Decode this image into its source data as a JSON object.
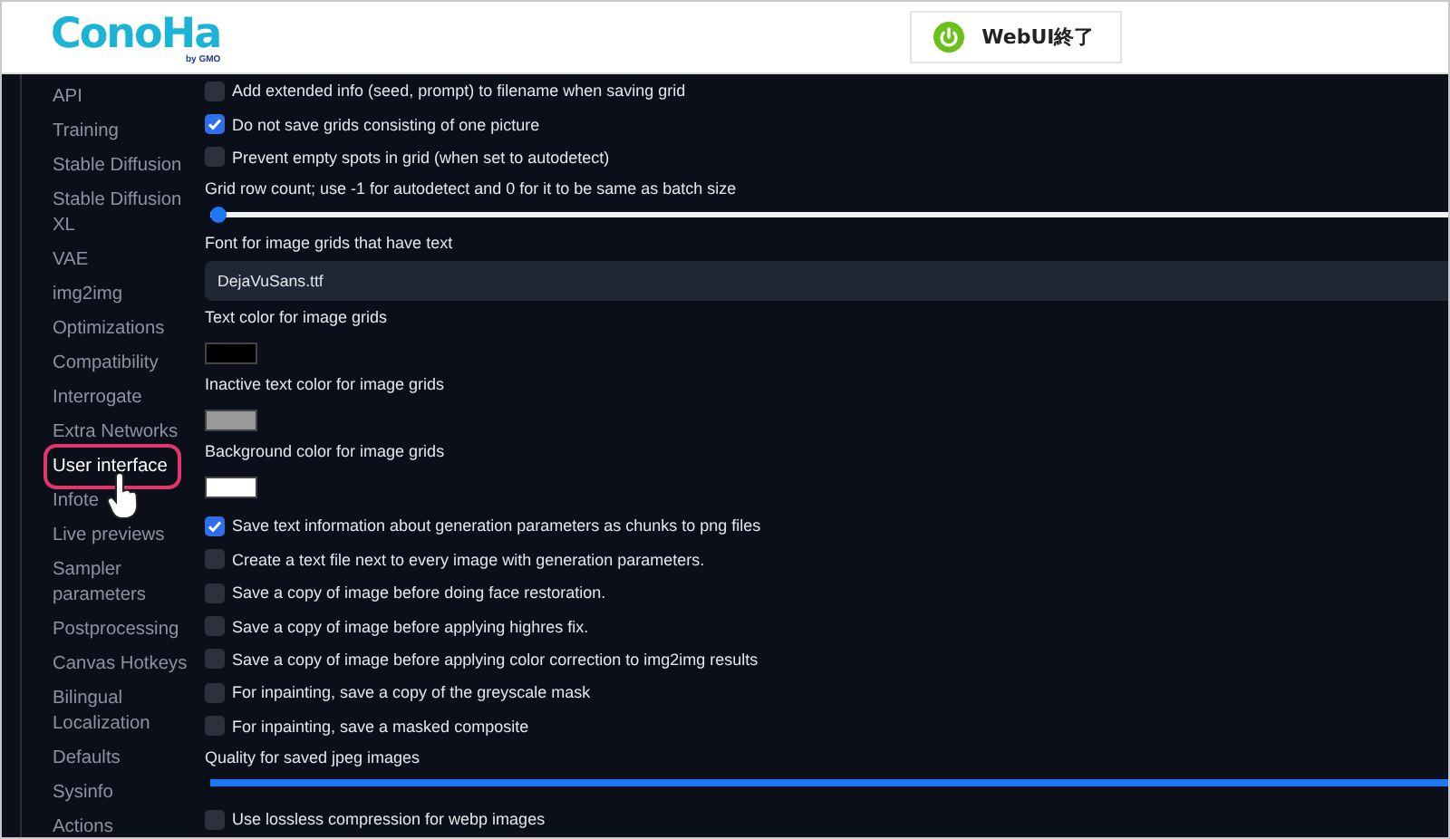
{
  "header": {
    "logo": "ConoHa",
    "logo_sub": "by GMO",
    "stop_button": "WebUI終了"
  },
  "sidebar": {
    "items": [
      {
        "label": "API",
        "selected": false
      },
      {
        "label": "Training",
        "selected": false
      },
      {
        "label": "Stable Diffusion",
        "selected": false
      },
      {
        "label": "Stable Diffusion XL",
        "selected": false
      },
      {
        "label": "VAE",
        "selected": false
      },
      {
        "label": "img2img",
        "selected": false
      },
      {
        "label": "Optimizations",
        "selected": false
      },
      {
        "label": "Compatibility",
        "selected": false
      },
      {
        "label": "Interrogate",
        "selected": false
      },
      {
        "label": "Extra Networks",
        "selected": false
      },
      {
        "label": "User interface",
        "selected": true
      },
      {
        "label": "Infote",
        "selected": false
      },
      {
        "label": "Live previews",
        "selected": false
      },
      {
        "label": "Sampler parameters",
        "selected": false
      },
      {
        "label": "Postprocessing",
        "selected": false
      },
      {
        "label": "Canvas Hotkeys",
        "selected": false
      },
      {
        "label": "Bilingual Localization",
        "selected": false
      },
      {
        "label": "Defaults",
        "selected": false
      },
      {
        "label": "Sysinfo",
        "selected": false
      },
      {
        "label": "Actions",
        "selected": false
      }
    ]
  },
  "settings": [
    {
      "kind": "checkbox",
      "label": "Add extended info (seed, prompt) to filename when saving grid",
      "checked": false
    },
    {
      "kind": "checkbox",
      "label": "Do not save grids consisting of one picture",
      "checked": true
    },
    {
      "kind": "checkbox",
      "label": "Prevent empty spots in grid (when set to autodetect)",
      "checked": false
    },
    {
      "kind": "slider",
      "label": "Grid row count; use -1 for autodetect and 0 for it to be same as batch size",
      "level": 0
    },
    {
      "kind": "field",
      "label": "Font for image grids that have text",
      "value": "DejaVuSans.ttf"
    },
    {
      "kind": "color",
      "label": "Text color for image grids",
      "color": "#000000"
    },
    {
      "kind": "color",
      "label": "Inactive text color for image grids",
      "color": "#999999"
    },
    {
      "kind": "color",
      "label": "Background color for image grids",
      "color": "#ffffff"
    },
    {
      "kind": "checkbox",
      "label": "Save text information about generation parameters as chunks to png files",
      "checked": true
    },
    {
      "kind": "checkbox",
      "label": "Create a text file next to every image with generation parameters.",
      "checked": false
    },
    {
      "kind": "checkbox",
      "label": "Save a copy of image before doing face restoration.",
      "checked": false
    },
    {
      "kind": "checkbox",
      "label": "Save a copy of image before applying highres fix.",
      "checked": false
    },
    {
      "kind": "checkbox",
      "label": "Save a copy of image before applying color correction to img2img results",
      "checked": false
    },
    {
      "kind": "checkbox",
      "label": "For inpainting, save a copy of the greyscale mask",
      "checked": false
    },
    {
      "kind": "checkbox",
      "label": "For inpainting, save a masked composite",
      "checked": false
    },
    {
      "kind": "slider",
      "label": "Quality for saved jpeg images",
      "level": 1
    },
    {
      "kind": "checkbox",
      "label": "Use lossless compression for webp images",
      "checked": false
    }
  ]
}
